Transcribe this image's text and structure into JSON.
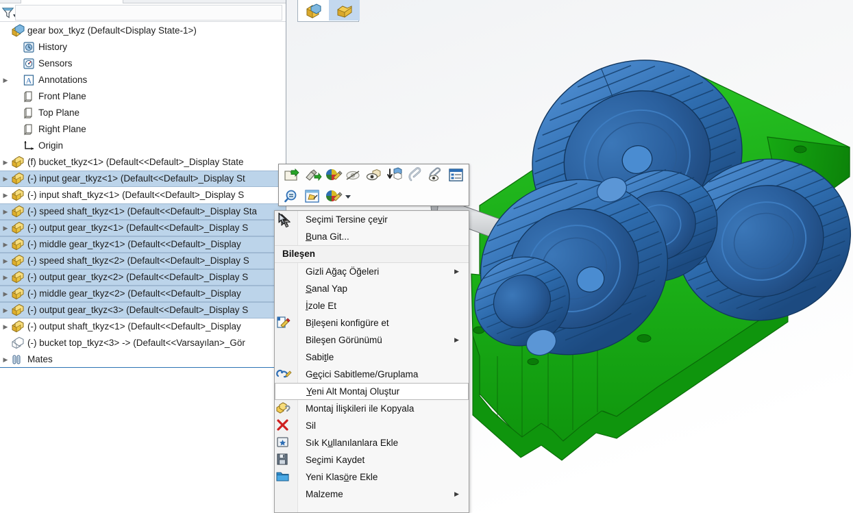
{
  "window": {
    "title": "gear box_tkyz  (Default<Display State-1>)"
  },
  "filter": {
    "placeholder": "",
    "value": "",
    "icon": "filter-icon",
    "dropdown_icon": "caret-down-icon"
  },
  "top_toolbar": {
    "buttons": [
      {
        "name": "display-state-button",
        "icon": "assembly-cube-icon",
        "active": false
      },
      {
        "name": "configuration-button",
        "icon": "assembly-part-icon",
        "active": true
      }
    ]
  },
  "tree": {
    "root": {
      "label": "gear box_tkyz  (Default<Display State-1>)",
      "icon": "assembly-icon",
      "expandable": false
    },
    "items": [
      {
        "label": "History",
        "icon": "history-icon",
        "arrow": false,
        "indent": 1,
        "selected": false
      },
      {
        "label": "Sensors",
        "icon": "sensors-icon",
        "arrow": false,
        "indent": 1,
        "selected": false
      },
      {
        "label": "Annotations",
        "icon": "annotations-icon",
        "arrow": true,
        "indent": 1,
        "selected": false
      },
      {
        "label": "Front Plane",
        "icon": "plane-icon",
        "arrow": false,
        "indent": 1,
        "selected": false
      },
      {
        "label": "Top Plane",
        "icon": "plane-icon",
        "arrow": false,
        "indent": 1,
        "selected": false
      },
      {
        "label": "Right Plane",
        "icon": "plane-icon",
        "arrow": false,
        "indent": 1,
        "selected": false
      },
      {
        "label": "Origin",
        "icon": "origin-icon",
        "arrow": false,
        "indent": 1,
        "selected": false
      },
      {
        "label": "(f) bucket_tkyz<1>  (Default<<Default>_Display State",
        "icon": "component-icon",
        "arrow": true,
        "indent": 0,
        "selected": false
      },
      {
        "label": "(-) input gear_tkyz<1>  (Default<<Default>_Display St",
        "icon": "component-icon",
        "arrow": true,
        "indent": 0,
        "selected": true
      },
      {
        "label": "(-) input shaft_tkyz<1>  (Default<<Default>_Display S",
        "icon": "component-icon",
        "arrow": true,
        "indent": 0,
        "selected": false
      },
      {
        "label": "(-) speed shaft_tkyz<1>  (Default<<Default>_Display Sta",
        "icon": "component-icon",
        "arrow": true,
        "indent": 0,
        "selected": true
      },
      {
        "label": "(-) output gear_tkyz<1>  (Default<<Default>_Display S",
        "icon": "component-icon",
        "arrow": true,
        "indent": 0,
        "selected": true
      },
      {
        "label": "(-) middle gear_tkyz<1>  (Default<<Default>_Display",
        "icon": "component-icon",
        "arrow": true,
        "indent": 0,
        "selected": true
      },
      {
        "label": "(-) speed shaft_tkyz<2>  (Default<<Default>_Display S",
        "icon": "component-icon",
        "arrow": true,
        "indent": 0,
        "selected": true
      },
      {
        "label": "(-) output gear_tkyz<2>  (Default<<Default>_Display S",
        "icon": "component-icon",
        "arrow": true,
        "indent": 0,
        "selected": true
      },
      {
        "label": "(-) middle gear_tkyz<2>  (Default<<Default>_Display",
        "icon": "component-icon",
        "arrow": true,
        "indent": 0,
        "selected": true
      },
      {
        "label": "(-) output gear_tkyz<3>  (Default<<Default>_Display S",
        "icon": "component-icon",
        "arrow": true,
        "indent": 0,
        "selected": true
      },
      {
        "label": "(-) output shaft_tkyz<1>  (Default<<Default>_Display",
        "icon": "component-icon",
        "arrow": true,
        "indent": 0,
        "selected": false
      },
      {
        "label": "(-) bucket top_tkyz<3> ->  (Default<<Varsayılan>_Gör",
        "icon": "component-hidden-icon",
        "arrow": false,
        "indent": 0,
        "selected": false
      },
      {
        "label": "Mates",
        "icon": "mates-icon",
        "arrow": true,
        "indent": 0,
        "selected": false
      }
    ]
  },
  "context_toolbar": {
    "row1": [
      {
        "name": "open-part-icon"
      },
      {
        "name": "edit-part-icon"
      },
      {
        "name": "edit-appearance-icon"
      },
      {
        "name": "hide-icon"
      },
      {
        "name": "show-hidden-icon"
      },
      {
        "name": "change-transparency-icon"
      },
      {
        "name": "view-mates-icon"
      },
      {
        "name": "hide-mates-icon"
      },
      {
        "name": "component-properties-icon"
      }
    ],
    "row2": [
      {
        "name": "zoom-to-selection-icon"
      },
      {
        "name": "select-other-icon"
      },
      {
        "name": "appearance-palette-icon"
      }
    ],
    "caret": {
      "name": "caret-down-icon"
    }
  },
  "context_menu": {
    "items": [
      {
        "label": "Seçimi Tersine çevir",
        "icon": "invert-selection-icon",
        "underline": "v",
        "type": "item",
        "submenu": false,
        "hover": false
      },
      {
        "label": "Buna Git...",
        "icon": "",
        "underline": "B",
        "type": "item",
        "submenu": false,
        "hover": false
      },
      {
        "label": "Bileşen",
        "icon": "",
        "type": "header",
        "submenu": false,
        "hover": false
      },
      {
        "label": "Gizli Ağaç Öğeleri",
        "icon": "",
        "type": "item",
        "submenu": true,
        "hover": false
      },
      {
        "label": "Sanal Yap",
        "icon": "",
        "underline": "S",
        "type": "item",
        "submenu": false,
        "hover": false
      },
      {
        "label": "İzole Et",
        "icon": "",
        "underline": "İ",
        "type": "item",
        "submenu": false,
        "hover": false
      },
      {
        "label": "Bileşeni konfigüre et",
        "icon": "configure-component-icon",
        "underline": "i",
        "type": "item",
        "submenu": false,
        "hover": false
      },
      {
        "label": "Bileşen Görünümü",
        "icon": "",
        "type": "item",
        "submenu": true,
        "hover": false
      },
      {
        "label": "Sabitle",
        "icon": "",
        "underline": "t",
        "type": "item",
        "submenu": false,
        "hover": false
      },
      {
        "label": "Geçici Sabitleme/Gruplama",
        "icon": "temp-fix-group-icon",
        "underline": "e",
        "type": "item",
        "submenu": false,
        "hover": false
      },
      {
        "label": "Yeni Alt Montaj Oluştur",
        "icon": "",
        "underline": "Y",
        "type": "item",
        "submenu": false,
        "hover": true
      },
      {
        "label": "Montaj İlişkileri ile Kopyala",
        "icon": "copy-with-mates-icon",
        "underline": "j",
        "type": "item",
        "submenu": false,
        "hover": false
      },
      {
        "label": "Sil",
        "icon": "delete-icon",
        "underline": "",
        "type": "item",
        "submenu": false,
        "hover": false
      },
      {
        "label": "Sık Kullanılanlara Ekle",
        "icon": "add-favorites-icon",
        "underline": "u",
        "type": "item",
        "submenu": false,
        "hover": false
      },
      {
        "label": "Seçimi Kaydet",
        "icon": "save-selection-icon",
        "underline": "ç",
        "type": "item",
        "submenu": false,
        "hover": false
      },
      {
        "label": "Yeni Klasöre Ekle",
        "icon": "new-folder-icon",
        "underline": "ö",
        "type": "item",
        "submenu": false,
        "hover": false
      },
      {
        "label": "Malzeme",
        "icon": "",
        "type": "item",
        "submenu": true,
        "hover": false
      }
    ]
  },
  "model": {
    "name": "gear box assembly",
    "colors": {
      "housing_green": "#15a813",
      "housing_green_dark": "#0e8a0c",
      "housing_green_light": "#22c31e",
      "gear_blue": "#2f6fb5",
      "gear_blue_dark": "#1d4f8a",
      "gear_blue_light": "#4f8fd4",
      "shaft_gray": "#b6b9bd",
      "shaft_gray_dark": "#8e9296",
      "background": "#f1f3f5"
    }
  }
}
